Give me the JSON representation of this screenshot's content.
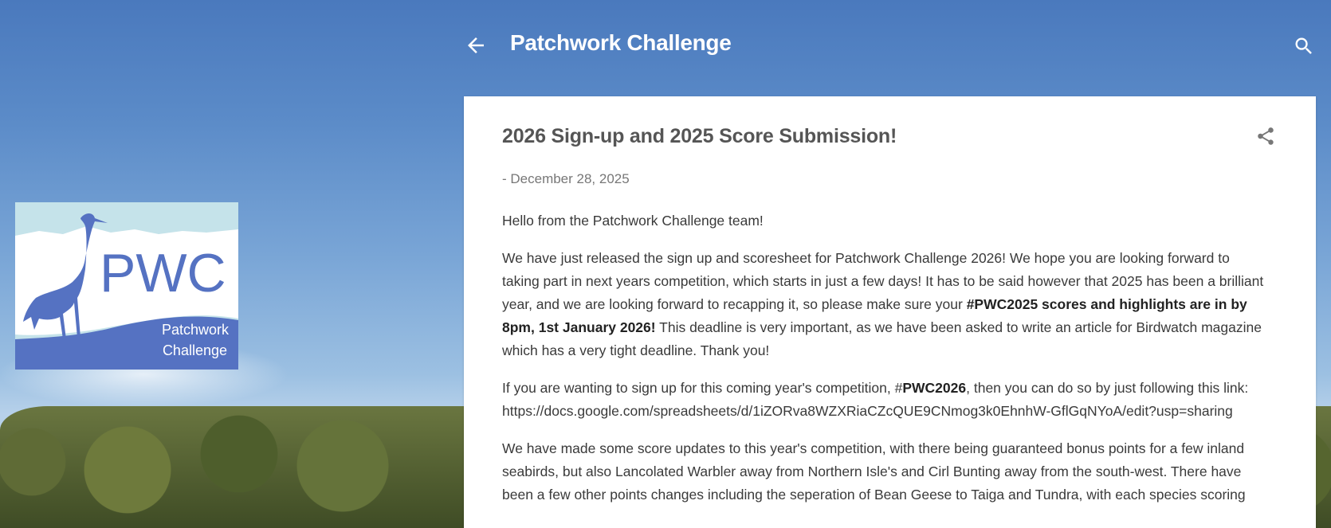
{
  "header": {
    "blog_title": "Patchwork Challenge",
    "back_icon": "arrow-left-icon",
    "search_icon": "search-icon"
  },
  "logo": {
    "text": "PWC",
    "subtitle_line1": "Patchwork",
    "subtitle_line2": "Challenge",
    "colors": {
      "bird": "#5572c2",
      "band": "#5572c2",
      "sky": "#c5e3ea"
    }
  },
  "post": {
    "title": "2026 Sign-up and 2025 Score Submission!",
    "date": "- December 28, 2025",
    "share_icon": "share-icon",
    "p1": "Hello from the Patchwork Challenge team!",
    "p2_a": "We have just released the sign up and scoresheet for Patchwork Challenge 2026! We hope you are looking forward to taking part in next years competition, which starts in just a few days! It has to be said however that 2025 has been a brilliant year, and we are looking forward to recapping it, so please make sure your ",
    "p2_bold": "#PWC2025 scores and highlights are in by 8pm, 1st January 2026!",
    "p2_b": " This deadline is very important, as we have been asked to write an article for Birdwatch magazine which has a very tight deadline. Thank you!",
    "p3_a": "If you are wanting to sign up for this coming year's competition, #",
    "p3_bold": "PWC2026",
    "p3_b": ", then you can do so by just following this link: ",
    "p3_link": "https://docs.google.com/spreadsheets/d/1iZORva8WZXRiaCZcQUE9CNmog3k0EhnhW-GflGqNYoA/edit?usp=sharing",
    "p4": "We have made some score updates to this year's competition, with there being guaranteed bonus points for a few inland seabirds, but also Lancolated Warbler away from Northern Isle's and Cirl Bunting away from the south-west. There have been a few other points changes including the seperation of Bean Geese to Taiga and Tundra, with each species scoring"
  }
}
